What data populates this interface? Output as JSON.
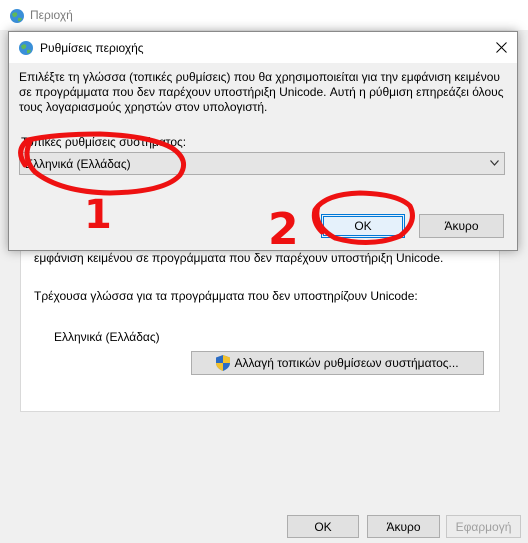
{
  "back_window": {
    "title": "Περιοχή",
    "description": "εμφάνιση κειμένου σε προγράμματα που δεν παρέχουν υποστήριξη Unicode.",
    "current_label": "Τρέχουσα γλώσσα για τα προγράμματα που δεν υποστηρίζουν Unicode:",
    "current_value": "Ελληνικά (Ελλάδας)",
    "change_button": "Αλλαγή τοπικών ρυθμίσεων συστήματος...",
    "footer": {
      "ok": "OK",
      "cancel": "Άκυρο",
      "apply": "Εφαρμογή"
    }
  },
  "dialog": {
    "title": "Ρυθμίσεις περιοχής",
    "description": "Επιλέξτε τη γλώσσα (τοπικές ρυθμίσεις) που θα χρησιμοποιείται για την εμφάνιση κειμένου σε προγράμματα που δεν παρέχουν υποστήριξη Unicode. Αυτή η ρύθμιση επηρεάζει όλους τους λογαριασμούς χρηστών στον υπολογιστή.",
    "current_label": "Τοπικές ρυθμίσεις συστήματος:",
    "selected_locale": "Ελληνικά (Ελλάδας)",
    "ok": "OK",
    "cancel": "Άκυρο"
  },
  "annotations": {
    "mark_1": "1",
    "mark_2": "2",
    "color": "#ee1111"
  },
  "icons": [
    "globe-icon",
    "close-icon",
    "chevron-down-icon",
    "uac-shield-icon"
  ]
}
